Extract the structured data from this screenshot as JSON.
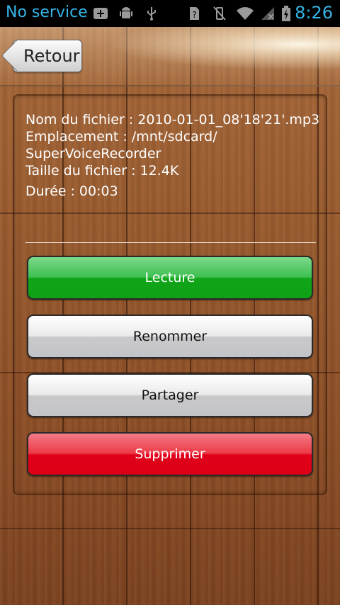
{
  "status_bar": {
    "carrier": "No service",
    "time": "8:26",
    "icons": [
      "add-notification-icon",
      "android-icon",
      "usb-icon",
      "sim-unknown-icon",
      "vibrate-icon",
      "wifi-icon",
      "no-signal-icon",
      "battery-charging-icon"
    ]
  },
  "header": {
    "back_label": "Retour"
  },
  "file_info": {
    "name_line": "Nom du fichier : 2010-01-01_08'18'21'.mp3",
    "location_line1": "Emplacement : /mnt/sdcard/",
    "location_line2": "SuperVoiceRecorder",
    "size_line": "Taille du fichier : 12.4K",
    "duration_line": "Durée : 00:03"
  },
  "actions": {
    "play_label": "Lecture",
    "rename_label": "Renommer",
    "share_label": "Partager",
    "delete_label": "Supprimer"
  },
  "colors": {
    "status_accent": "#33b5e5",
    "play": "#10a418",
    "delete": "#e0001a",
    "neutral": "#c9c9cb"
  }
}
